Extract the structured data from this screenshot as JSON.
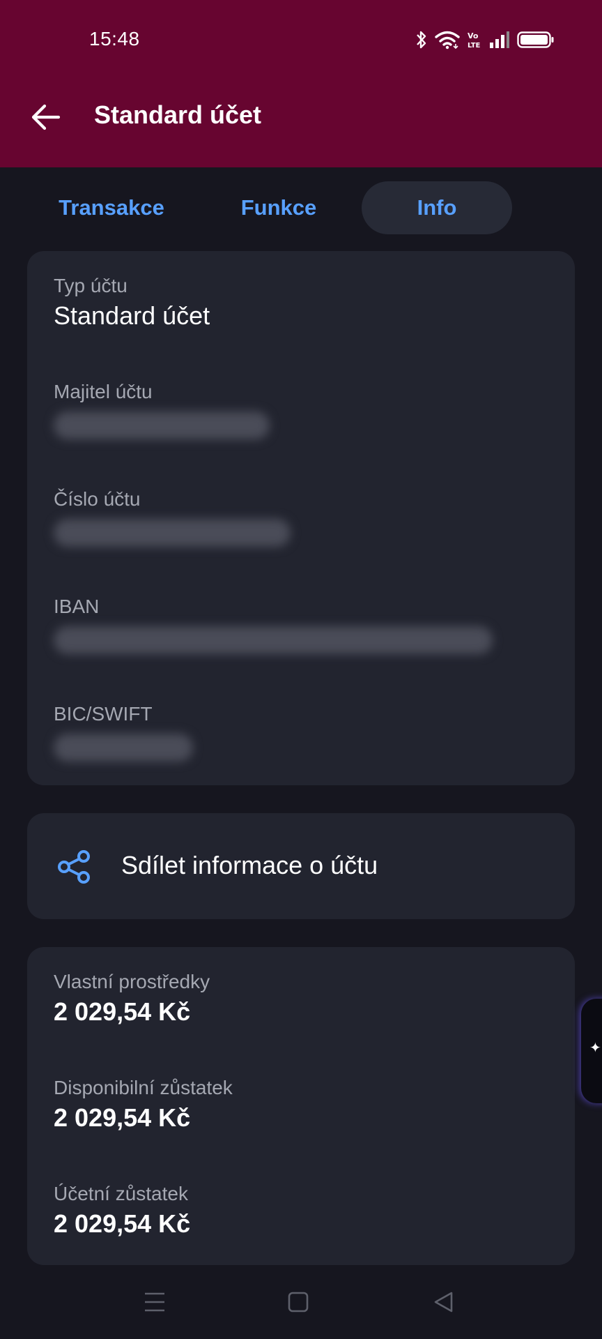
{
  "status_bar": {
    "time": "15:48",
    "icons": [
      "bluetooth-icon",
      "wifi-icon",
      "volte-icon",
      "signal-icon",
      "battery-icon"
    ]
  },
  "header": {
    "title": "Standard účet",
    "back_icon": "arrow-left-icon"
  },
  "tabs": [
    {
      "label": "Transakce",
      "active": false
    },
    {
      "label": "Funkce",
      "active": false
    },
    {
      "label": "Info",
      "active": true
    }
  ],
  "account_info": {
    "type_label": "Typ účtu",
    "type_value": "Standard účet",
    "owner_label": "Majitel účtu",
    "number_label": "Číslo účtu",
    "iban_label": "IBAN",
    "bic_label": "BIC/SWIFT"
  },
  "share": {
    "label": "Sdílet informace o účtu",
    "icon": "share-icon"
  },
  "balances": {
    "own_funds_label": "Vlastní prostředky",
    "own_funds_value": "2 029,54 Kč",
    "available_label": "Disponibilní zůstatek",
    "available_value": "2 029,54 Kč",
    "accounting_label": "Účetní zůstatek",
    "accounting_value": "2 029,54 Kč"
  },
  "edge_handle": {
    "icon": "sparkle-icon",
    "glyph": "✦"
  },
  "nav_bar": {
    "buttons": [
      "menu-icon",
      "home-square-icon",
      "back-triangle-icon"
    ]
  },
  "colors": {
    "header_bg": "#670530",
    "page_bg": "#16161f",
    "card_bg": "#22242f",
    "accent": "#58a0ff"
  }
}
